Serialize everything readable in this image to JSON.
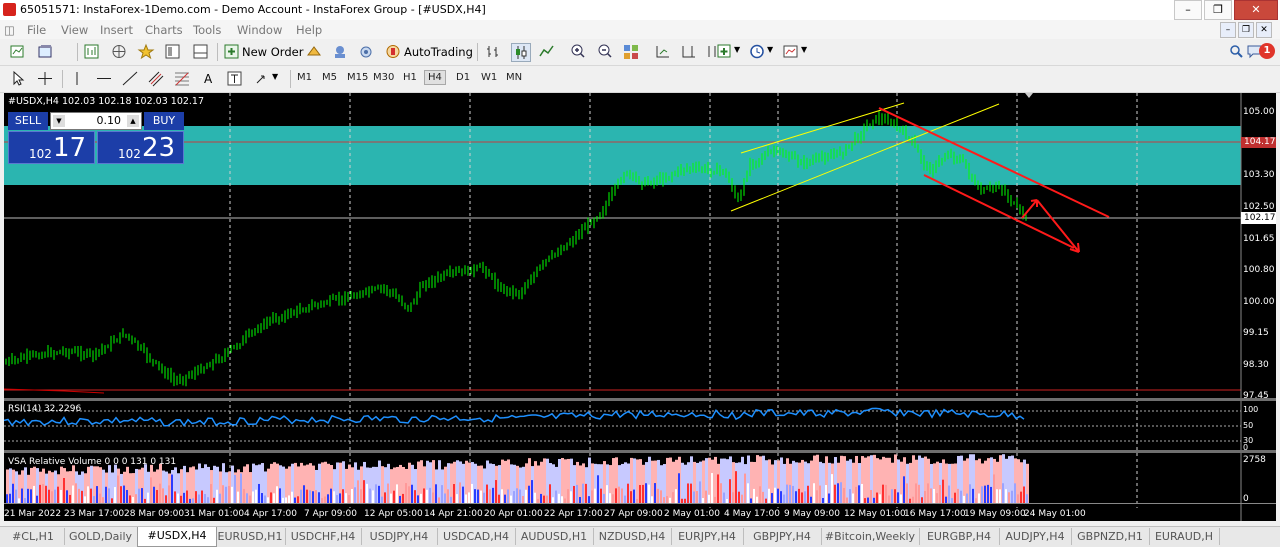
{
  "window": {
    "title": "65051571: InstaForex-1Demo.com - Demo Account - InstaForex Group - [#USDX,H4]"
  },
  "menu": [
    "File",
    "View",
    "Insert",
    "Charts",
    "Tools",
    "Window",
    "Help"
  ],
  "notifications": {
    "count": "1"
  },
  "toolbar": {
    "new_order": "New Order",
    "autotrading": "AutoTrading",
    "timeframes": [
      "M1",
      "M5",
      "M15",
      "M30",
      "H1",
      "H4",
      "D1",
      "W1",
      "MN"
    ],
    "active_timeframe": "H4"
  },
  "chart": {
    "symbol_info": "#USDX,H4  102.03 102.18 102.03 102.17",
    "trade": {
      "sell": "SELL",
      "buy": "BUY",
      "lot": "0.10",
      "sell_small": "102",
      "sell_big": "17",
      "buy_small": "102",
      "buy_big": "23"
    },
    "price_axis": [
      "105.00",
      "103.30",
      "102.50",
      "101.65",
      "100.80",
      "100.00",
      "99.15",
      "98.30",
      "97.45"
    ],
    "tag_resistance": "104.17",
    "tag_current": "102.17",
    "rsi_label": "RSI(14) 32.2296",
    "rsi_axis": [
      "100",
      "50",
      "30",
      "0"
    ],
    "vsa_label": "VSA Relative Volume 0 0 0 131 0 131",
    "vsa_axis": [
      "2758",
      "0"
    ],
    "time_axis": [
      "21 Mar 2022",
      "23 Mar 17:00",
      "28 Mar 09:00",
      "31 Mar 01:00",
      "4 Apr 17:00",
      "7 Apr 09:00",
      "12 Apr 05:00",
      "14 Apr 21:00",
      "20 Apr 01:00",
      "22 Apr 17:00",
      "27 Apr 09:00",
      "2 May 01:00",
      "4 May 17:00",
      "9 May 09:00",
      "12 May 01:00",
      "16 May 17:00",
      "19 May 09:00",
      "24 May 01:00"
    ],
    "colors": {
      "zone": "#2bb5b0",
      "candles": "#00ff00",
      "channel_up": "#ffff00",
      "channel_down": "#ff0000",
      "rsi": "#1e90ff"
    }
  },
  "tabs": [
    "#CL,H1",
    "GOLD,Daily",
    "#USDX,H4",
    "EURUSD,H1",
    "USDCHF,H4",
    "USDJPY,H4",
    "USDCAD,H4",
    "AUDUSD,H1",
    "NZDUSD,H4",
    "EURJPY,H4",
    "GBPJPY,H4",
    "#Bitcoin,Weekly",
    "EURGBP,H4",
    "AUDJPY,H4",
    "GBPNZD,H1",
    "EURAUD,H"
  ],
  "active_tab": "#USDX,H4"
}
